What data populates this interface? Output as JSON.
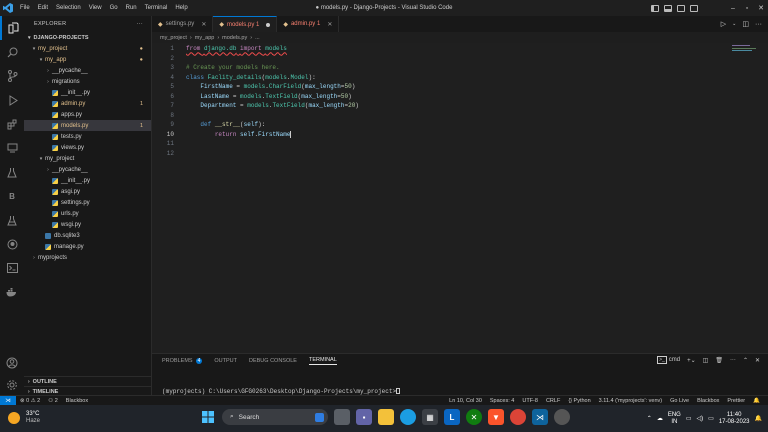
{
  "window": {
    "title": "● models.py - Django-Projects - Visual Studio Code",
    "menu": [
      "File",
      "Edit",
      "Selection",
      "View",
      "Go",
      "Run",
      "Terminal",
      "Help"
    ]
  },
  "sidebar": {
    "header": "EXPLORER",
    "section": "DJANGO-PROJECTS",
    "tree": [
      {
        "label": "my_project",
        "depth": 0,
        "kind": "folder-open",
        "status": "mod",
        "badge": "●"
      },
      {
        "label": "my_app",
        "depth": 1,
        "kind": "folder-open",
        "status": "mod",
        "badge": "●"
      },
      {
        "label": "__pycache__",
        "depth": 2,
        "kind": "folder",
        "status": "",
        "badge": ""
      },
      {
        "label": "migrations",
        "depth": 2,
        "kind": "folder",
        "status": "",
        "badge": ""
      },
      {
        "label": "__init__.py",
        "depth": 2,
        "kind": "py",
        "status": "",
        "badge": ""
      },
      {
        "label": "admin.py",
        "depth": 2,
        "kind": "py",
        "status": "mod",
        "badge": "1"
      },
      {
        "label": "apps.py",
        "depth": 2,
        "kind": "py",
        "status": "",
        "badge": ""
      },
      {
        "label": "models.py",
        "depth": 2,
        "kind": "py",
        "status": "mod",
        "badge": "1",
        "selected": true
      },
      {
        "label": "tests.py",
        "depth": 2,
        "kind": "py",
        "status": "",
        "badge": ""
      },
      {
        "label": "views.py",
        "depth": 2,
        "kind": "py",
        "status": "",
        "badge": ""
      },
      {
        "label": "my_project",
        "depth": 1,
        "kind": "folder-open",
        "status": "",
        "badge": ""
      },
      {
        "label": "__pycache__",
        "depth": 2,
        "kind": "folder",
        "status": "",
        "badge": ""
      },
      {
        "label": "__init__.py",
        "depth": 2,
        "kind": "py",
        "status": "",
        "badge": ""
      },
      {
        "label": "asgi.py",
        "depth": 2,
        "kind": "py",
        "status": "",
        "badge": ""
      },
      {
        "label": "settings.py",
        "depth": 2,
        "kind": "py",
        "status": "",
        "badge": ""
      },
      {
        "label": "urls.py",
        "depth": 2,
        "kind": "py",
        "status": "",
        "badge": ""
      },
      {
        "label": "wsgi.py",
        "depth": 2,
        "kind": "py",
        "status": "",
        "badge": ""
      },
      {
        "label": "db.sqlite3",
        "depth": 1,
        "kind": "db",
        "status": "",
        "badge": ""
      },
      {
        "label": "manage.py",
        "depth": 1,
        "kind": "py",
        "status": "",
        "badge": ""
      },
      {
        "label": "myprojects",
        "depth": 0,
        "kind": "folder",
        "status": "",
        "badge": ""
      }
    ],
    "outline": "OUTLINE",
    "timeline": "TIMELINE"
  },
  "tabs": [
    {
      "label": "settings.py",
      "state": "close"
    },
    {
      "label": "models.py 1",
      "state": "dirty",
      "active": true
    },
    {
      "label": "admin.py 1",
      "state": "close"
    }
  ],
  "breadcrumb": [
    "my_project",
    "my_app",
    "models.py",
    "..."
  ],
  "code_lines": [
    {
      "n": "1",
      "html": "<span class='kw'>from</span> <span class='cls'>django.db</span> <span class='kw'>import</span> <span class='cls'>models</span>"
    },
    {
      "n": "2",
      "html": ""
    },
    {
      "n": "3",
      "html": "<span class='cm'># Create your models here.</span>"
    },
    {
      "n": "4",
      "html": "<span class='kb'>class</span> <span class='cls'>Faclity_details</span>(<span class='cls'>models</span>.<span class='cls'>Model</span>):"
    },
    {
      "n": "5",
      "html": "    <span class='var'>FirstName</span> = <span class='cls'>models</span>.<span class='cls'>CharField</span>(<span class='var'>max_length</span>=<span class='num'>50</span>)"
    },
    {
      "n": "6",
      "html": "    <span class='var'>LastName</span> = <span class='cls'>models</span>.<span class='cls'>TextField</span>(<span class='var'>max_length</span>=<span class='num'>50</span>)"
    },
    {
      "n": "7",
      "html": "    <span class='var'>Department</span> = <span class='cls'>models</span>.<span class='cls'>TextField</span>(<span class='var'>max_length</span>=<span class='num'>20</span>)"
    },
    {
      "n": "8",
      "html": ""
    },
    {
      "n": "9",
      "html": "    <span class='kb'>def</span> <span class='fn'>__str__</span>(<span class='var'>self</span>):"
    },
    {
      "n": "10",
      "html": "        <span class='kw'>return</span> <span class='var'>self</span>.<span class='var'>FirstName</span>",
      "current": true
    },
    {
      "n": "11",
      "html": ""
    },
    {
      "n": "12",
      "html": ""
    }
  ],
  "panel": {
    "tabs": [
      "PROBLEMS",
      "OUTPUT",
      "DEBUG CONSOLE",
      "TERMINAL"
    ],
    "problems_count": "4",
    "shell": "cmd",
    "terminal_prompt": "(myprojects) C:\\Users\\GFG0263\\Desktop\\Django-Projects\\my_project>"
  },
  "statusbar": {
    "left": [
      "⊗ 0 ⚠ 2",
      "⚇ 2",
      "Blackbox"
    ],
    "right": [
      "Ln 10, Col 30",
      "Spaces: 4",
      "UTF-8",
      "CRLF",
      "{} Python",
      "3.11.4 ('myprojects': venv)",
      "Go Live",
      "Blackbox",
      "Prettier"
    ]
  },
  "taskbar": {
    "temp": "33°C",
    "weather": "Haze",
    "search_placeholder": "Search",
    "lang_line1": "ENG",
    "lang_line2": "IN",
    "time": "11:40",
    "date": "17-08-2023"
  },
  "colors": {
    "accent": "#0078d4",
    "modified": "#e2c08d",
    "error": "#f88070"
  }
}
